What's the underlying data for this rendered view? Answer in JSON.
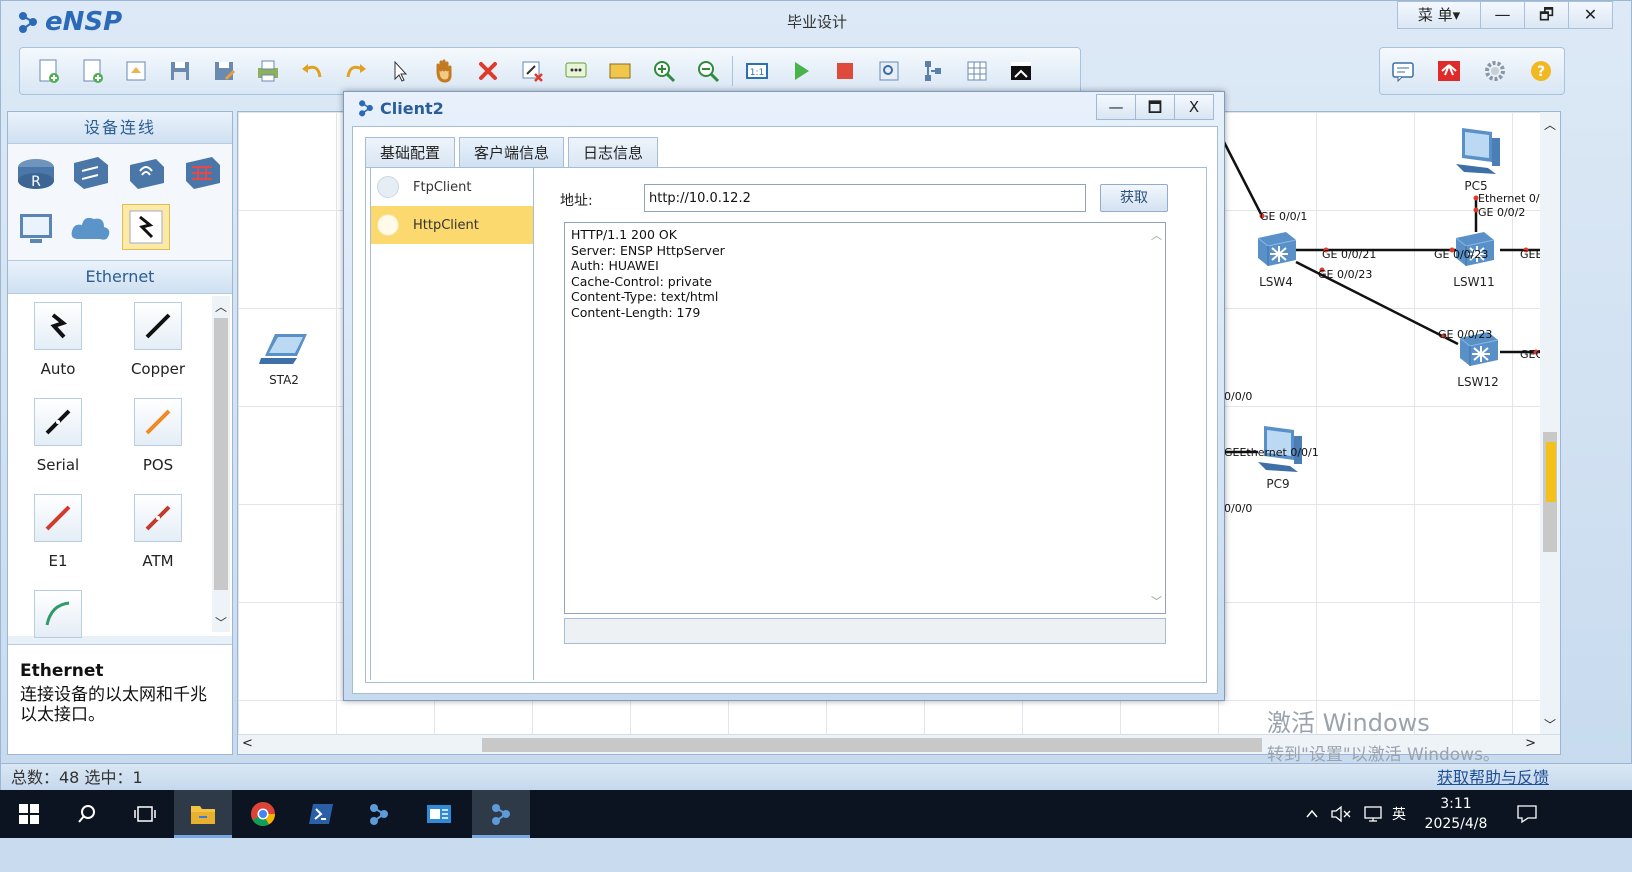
{
  "app": {
    "logo_text": "eNSP",
    "title": "毕业设计",
    "menu_label": "菜 单▾",
    "minimize": "—",
    "restore": "🗗",
    "close": "✕"
  },
  "toolbar": {
    "icons": [
      "new-topology-icon",
      "new-blank-icon",
      "open-icon",
      "save-icon",
      "save-as-icon",
      "print-icon",
      "undo-icon",
      "redo-icon",
      "select-icon",
      "pan-hand-icon",
      "delete-icon",
      "delete-link-icon",
      "text-icon",
      "rectangle-icon",
      "zoom-in-icon",
      "zoom-out-icon",
      "fit-icon",
      "start-icon",
      "stop-icon",
      "capture-icon",
      "topology-icon",
      "grid-icon",
      "terminal-icon"
    ],
    "right_icons": [
      "chat-icon",
      "huawei-icon",
      "settings-icon",
      "help-icon"
    ]
  },
  "left_panel": {
    "header": "设备连线",
    "section": "Ethernet",
    "cables": [
      {
        "label": "Auto"
      },
      {
        "label": "Copper"
      },
      {
        "label": "Serial"
      },
      {
        "label": "POS"
      },
      {
        "label": "E1"
      },
      {
        "label": "ATM"
      }
    ],
    "desc_title": "Ethernet",
    "desc_text": "连接设备的以太网和千兆以太接口。"
  },
  "canvas": {
    "nodes": {
      "sta2": "STA2",
      "pc5": "PC5",
      "lsw4": "LSW4",
      "lsw11": "LSW11",
      "lsw12": "LSW12",
      "pc9": "PC9"
    },
    "ports": {
      "p1": "GE 0/0/1",
      "p2": "GE 0/0/21",
      "p3": "GE 0/0/23",
      "p4": "GE 0/0/23",
      "p5": "GE 0/0/23",
      "p6": "Ethernet 0/0/",
      "p7": "GE 0/0/2",
      "p8": "GEE",
      "p9": "GEG",
      "p10": "0/0/0",
      "p11": "GEEthernet 0/0/1",
      "p12": "0/0/0"
    },
    "watermark_line1": "激活 Windows",
    "watermark_line2": "转到\"设置\"以激活 Windows。"
  },
  "status": {
    "counts": "总数：48  选中：1",
    "help_link": "获取帮助与反馈"
  },
  "dialog": {
    "title": "Client2",
    "minimize": "—",
    "restore": "🗖",
    "close": "X",
    "tabs": [
      "基础配置",
      "客户端信息",
      "日志信息"
    ],
    "clients": [
      "FtpClient",
      "HttpClient"
    ],
    "address_label": "地址:",
    "address_value": "http://10.0.12.2",
    "fetch_button": "获取",
    "response_lines": [
      "HTTP/1.1 200 OK",
      "Server: ENSP HttpServer",
      "Auth: HUAWEI",
      "Cache-Control: private",
      "Content-Type: text/html",
      "Content-Length: 179"
    ]
  },
  "taskbar": {
    "ime": "英",
    "time": "3:11",
    "date": "2025/4/8"
  }
}
